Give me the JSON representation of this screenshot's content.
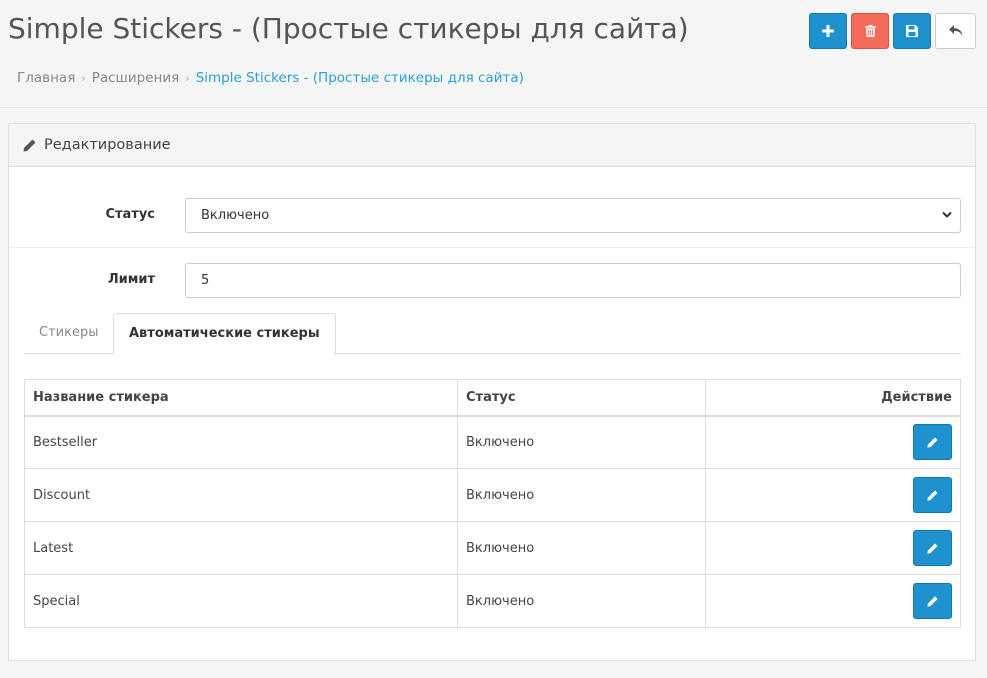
{
  "header": {
    "title": "Simple Stickers - (Простые стикеры для сайта)",
    "breadcrumb": [
      "Главная",
      "Расширения",
      "Simple Stickers - (Простые стикеры для сайта)"
    ]
  },
  "toolbar": {
    "icons": [
      "plus-icon",
      "trash-icon",
      "save-icon",
      "reply-icon"
    ]
  },
  "panel": {
    "title": "Редактирование",
    "status_label": "Статус",
    "status_value": "Включено",
    "limit_label": "Лимит",
    "limit_value": "5"
  },
  "tabs": [
    {
      "label": "Стикеры",
      "active": false
    },
    {
      "label": "Автоматические стикеры",
      "active": true
    }
  ],
  "table": {
    "headers": [
      "Название стикера",
      "Статус",
      "Действие"
    ],
    "rows": [
      {
        "name": "Bestseller",
        "status": "Включено"
      },
      {
        "name": "Discount",
        "status": "Включено"
      },
      {
        "name": "Latest",
        "status": "Включено"
      },
      {
        "name": "Special",
        "status": "Включено"
      }
    ]
  },
  "colors": {
    "primary": "#1e91cf",
    "danger": "#f56b5b",
    "link": "#2aa0d4"
  }
}
